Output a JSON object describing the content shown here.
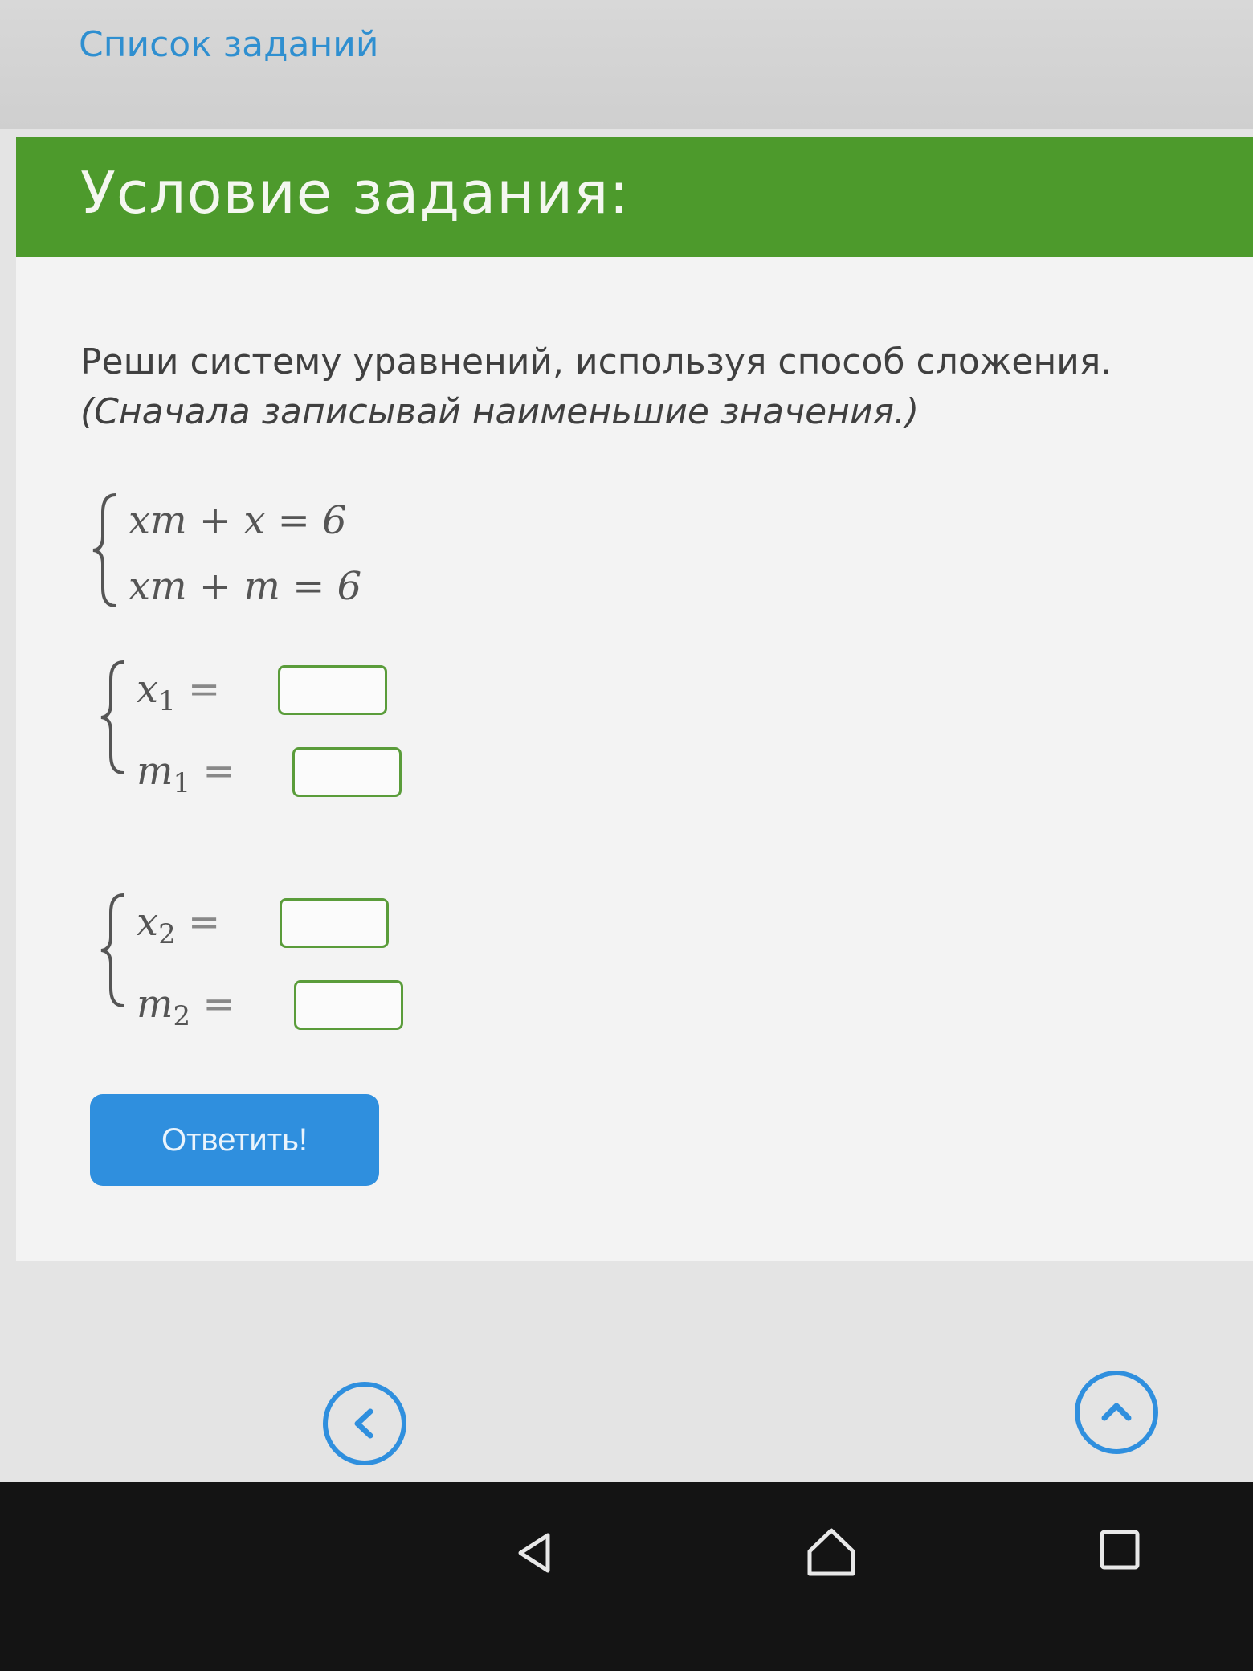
{
  "header": {
    "task_list_link": "Список заданий"
  },
  "task": {
    "title": "Условие задания:",
    "instruction_line1": "Реши систему уравнений, используя способ сложения.",
    "instruction_line2": "(Сначала записывай наименьшие значения.)",
    "system": {
      "eq1": "xm + x = 6",
      "eq2": "xm + m = 6"
    },
    "answers": {
      "pair1": {
        "x_var": "x",
        "x_sub": "1",
        "m_var": "m",
        "m_sub": "1",
        "x_value": "",
        "m_value": ""
      },
      "pair2": {
        "x_var": "x",
        "x_sub": "2",
        "m_var": "m",
        "m_sub": "2",
        "x_value": "",
        "m_value": ""
      },
      "equals": "="
    },
    "submit_label": "Ответить!"
  },
  "navigation": {
    "back_icon": "chevron-left-icon",
    "top_icon": "chevron-up-icon"
  },
  "android": {
    "back_icon": "triangle-back-icon",
    "home_icon": "home-icon",
    "recents_icon": "square-recents-icon"
  },
  "colors": {
    "header_green": "#4d9a2c",
    "link_blue": "#2f8fd0",
    "button_blue": "#2f8fde",
    "input_border_green": "#5a9c3a"
  }
}
